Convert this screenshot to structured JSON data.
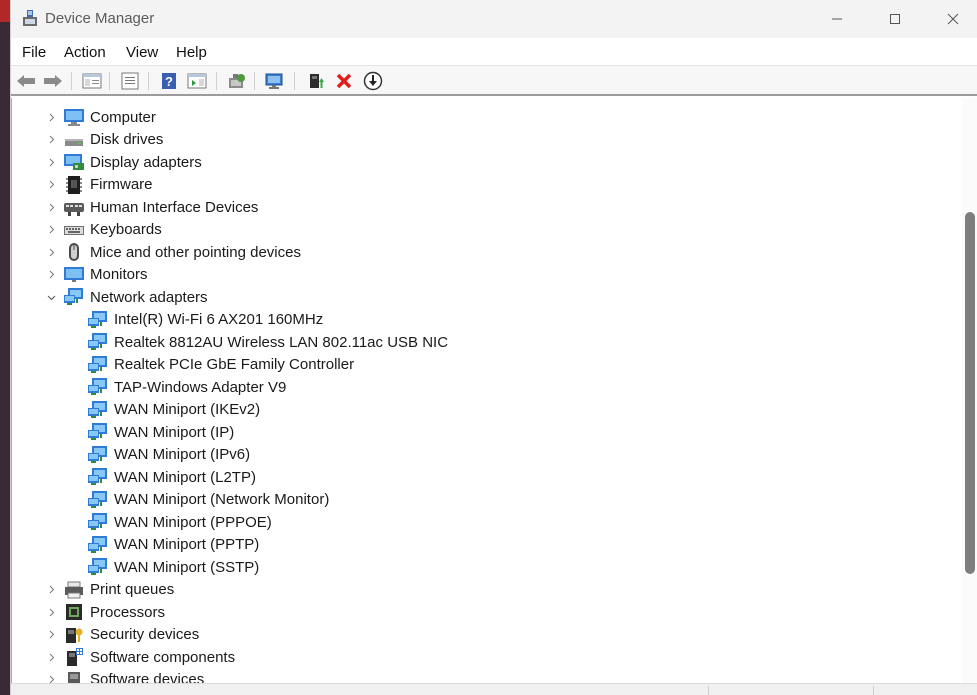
{
  "window": {
    "title": "Device Manager"
  },
  "menu": [
    "File",
    "Action",
    "View",
    "Help"
  ],
  "toolbar": [
    "back-arrow-icon",
    "forward-arrow-icon",
    "show-hide-console-tree-icon",
    "properties-icon",
    "help-icon",
    "action-pane-icon",
    "scan-hardware-icon",
    "monitor-network-icon",
    "enable-device-icon",
    "uninstall-device-icon",
    "update-driver-icon"
  ],
  "tree": [
    {
      "label": "Computer",
      "icon": "computer-icon",
      "expanded": false
    },
    {
      "label": "Disk drives",
      "icon": "disk-drive-icon",
      "expanded": false
    },
    {
      "label": "Display adapters",
      "icon": "display-adapter-icon",
      "expanded": false
    },
    {
      "label": "Firmware",
      "icon": "firmware-icon",
      "expanded": false
    },
    {
      "label": "Human Interface Devices",
      "icon": "hid-icon",
      "expanded": false
    },
    {
      "label": "Keyboards",
      "icon": "keyboard-icon",
      "expanded": false
    },
    {
      "label": "Mice and other pointing devices",
      "icon": "mouse-icon",
      "expanded": false
    },
    {
      "label": "Monitors",
      "icon": "monitor-icon",
      "expanded": false
    },
    {
      "label": "Network adapters",
      "icon": "network-adapter-icon",
      "expanded": true,
      "children": [
        "Intel(R) Wi-Fi 6 AX201 160MHz",
        "Realtek 8812AU Wireless LAN 802.11ac USB NIC",
        "Realtek PCIe GbE Family Controller",
        "TAP-Windows Adapter V9",
        "WAN Miniport (IKEv2)",
        "WAN Miniport (IP)",
        "WAN Miniport (IPv6)",
        "WAN Miniport (L2TP)",
        "WAN Miniport (Network Monitor)",
        "WAN Miniport (PPPOE)",
        "WAN Miniport (PPTP)",
        "WAN Miniport (SSTP)"
      ]
    },
    {
      "label": "Print queues",
      "icon": "printer-icon",
      "expanded": false
    },
    {
      "label": "Processors",
      "icon": "processor-icon",
      "expanded": false
    },
    {
      "label": "Security devices",
      "icon": "security-device-icon",
      "expanded": false
    },
    {
      "label": "Software components",
      "icon": "software-component-icon",
      "expanded": false
    },
    {
      "label": "Software devices",
      "icon": "software-device-icon",
      "expanded": false
    }
  ]
}
